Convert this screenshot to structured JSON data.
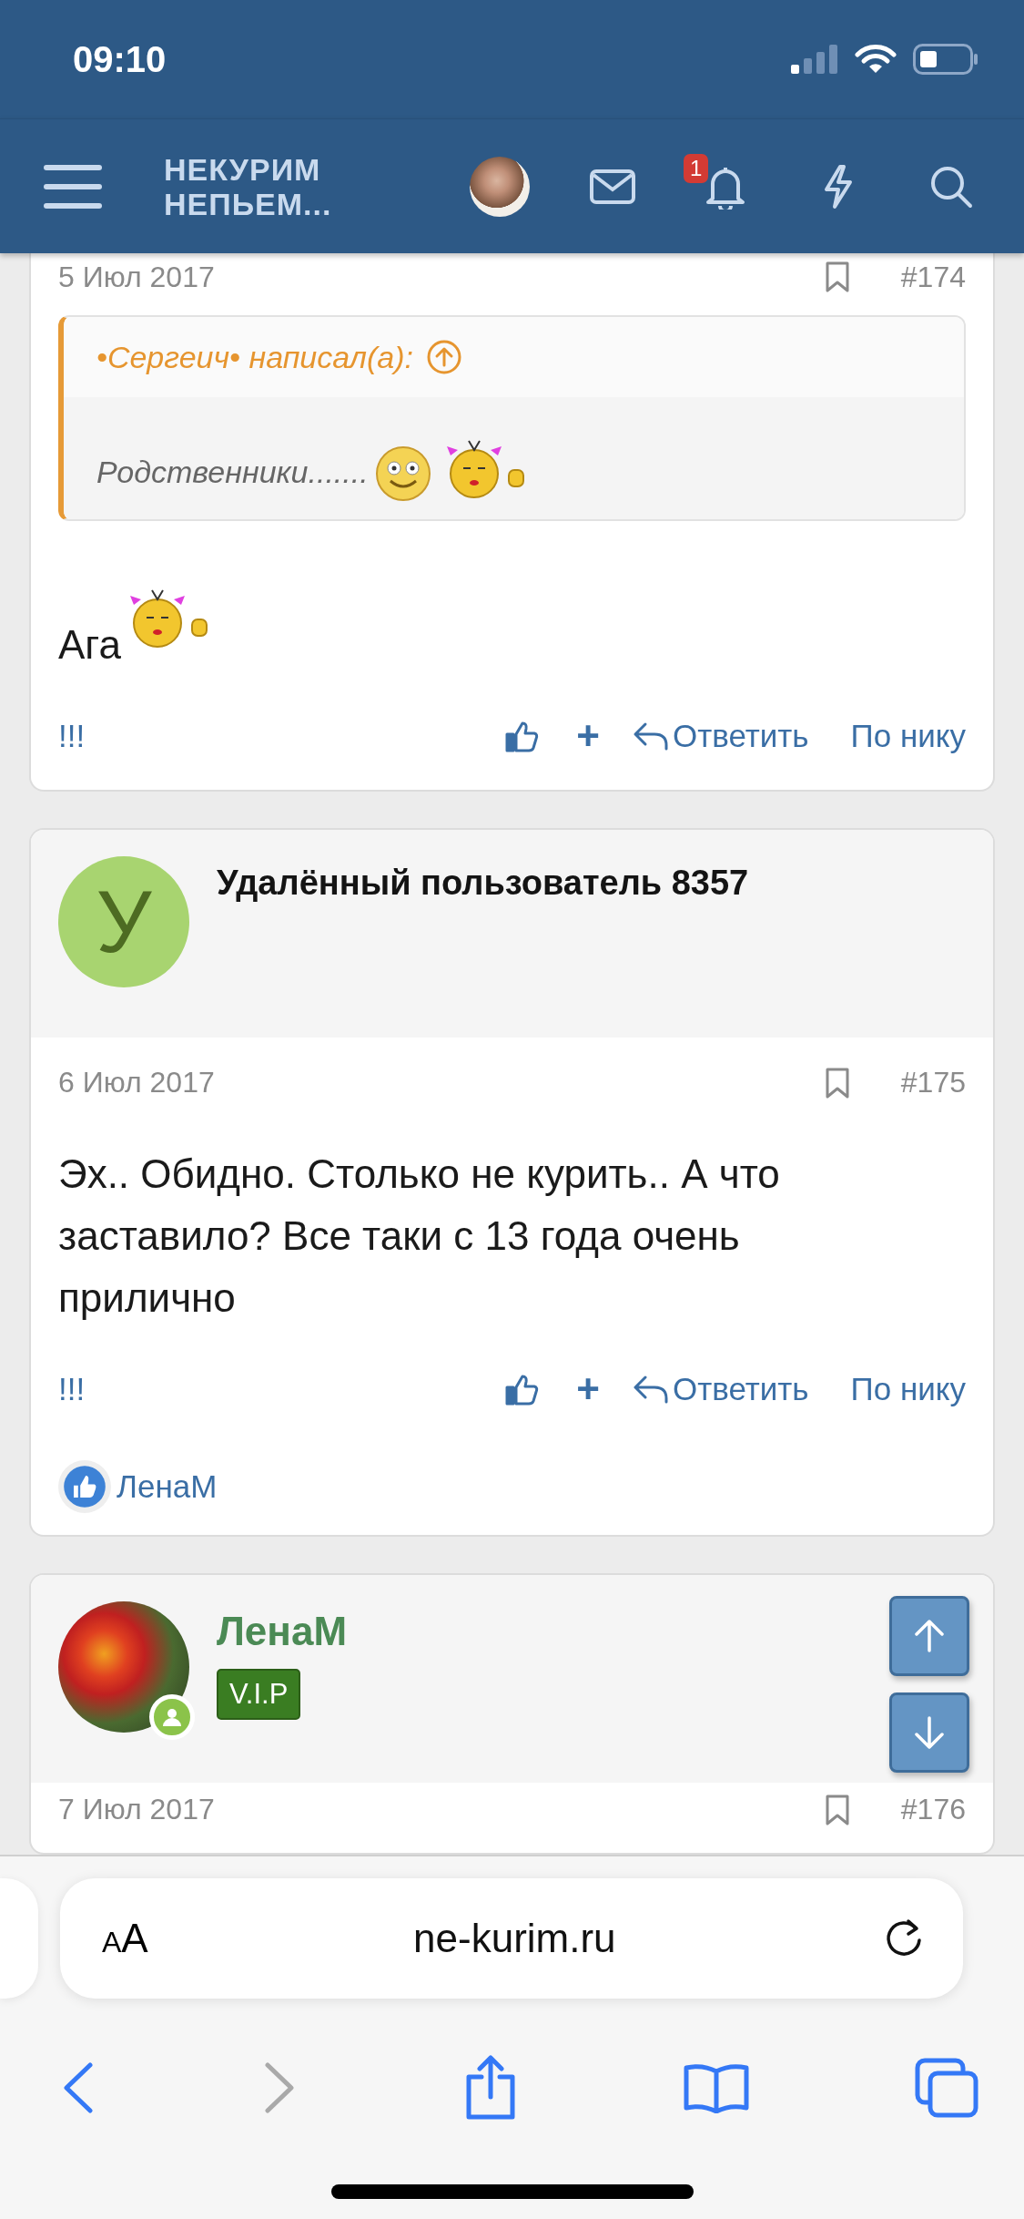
{
  "status_bar": {
    "time": "09:10"
  },
  "nav": {
    "logo_lines": [
      "НЕКУРИМ",
      "НЕПЬЕМ..."
    ],
    "notification_count": "1"
  },
  "posts": [
    {
      "date": "5 Июл 2017",
      "number": "#174",
      "quote": {
        "author_line": "•Сергеич• написал(а):",
        "text": "Родственники.......",
        "smileys": [
          {
            "kind": "smile"
          },
          {
            "kind": "kiss"
          }
        ]
      },
      "body": "Ага",
      "body_smileys": [
        {
          "kind": "kiss"
        }
      ],
      "actions": {
        "report": "!!!",
        "plus": "+",
        "reply": "Ответить",
        "by_nick": "По нику"
      }
    },
    {
      "author": {
        "name": "Удалённый пользователь 8357",
        "avatar": {
          "kind": "letter",
          "initial": "У"
        }
      },
      "date": "6 Июл 2017",
      "number": "#175",
      "body": "Эх.. Обидно. Столько не курить.. А что заставило? Все таки с 13 года очень прилично",
      "actions": {
        "report": "!!!",
        "plus": "+",
        "reply": "Ответить",
        "by_nick": "По нику"
      },
      "reactions": [
        {
          "name": "ЛенаМ"
        }
      ]
    },
    {
      "author": {
        "name": "ЛенаМ",
        "title": "V.I.P",
        "avatar": {
          "kind": "photo"
        },
        "online": true
      },
      "date": "7 Июл 2017",
      "number": "#176"
    }
  ],
  "browser": {
    "text_size": "AA",
    "url": "ne-kurim.ru"
  }
}
